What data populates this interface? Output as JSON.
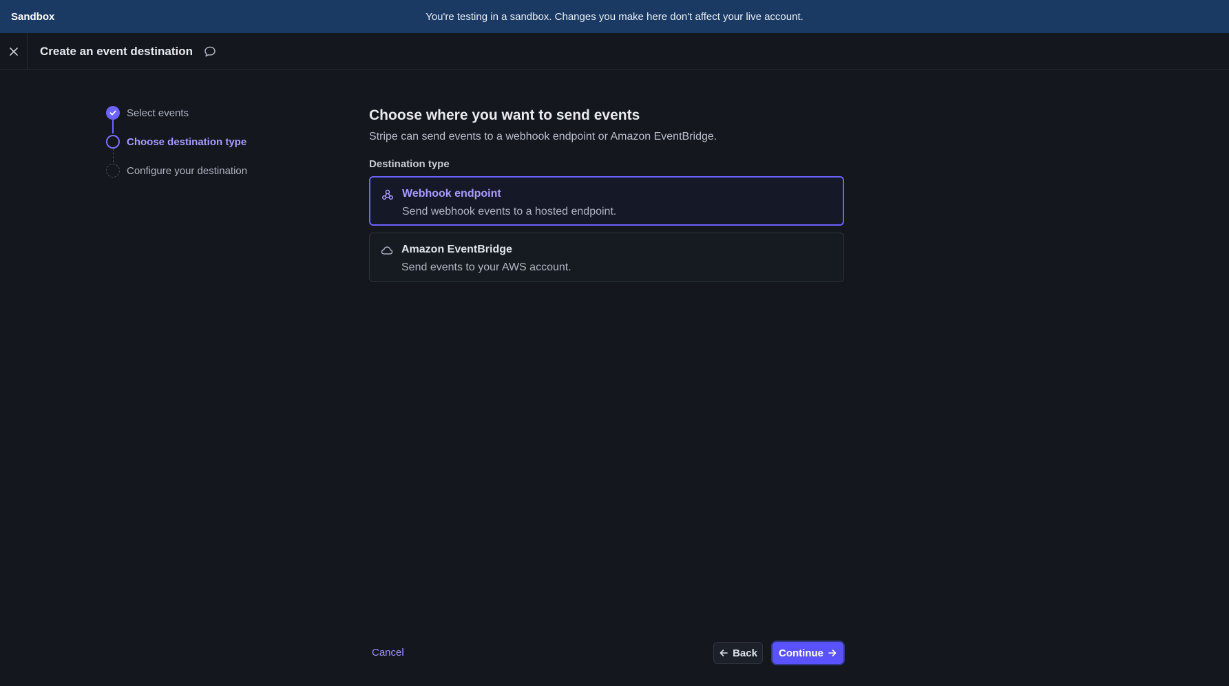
{
  "banner": {
    "label": "Sandbox",
    "message": "You're testing in a sandbox. Changes you make here don't affect your live account."
  },
  "header": {
    "title": "Create an event destination"
  },
  "steps": [
    {
      "label": "Select events",
      "state": "done"
    },
    {
      "label": "Choose destination type",
      "state": "current"
    },
    {
      "label": "Configure your destination",
      "state": "pending"
    }
  ],
  "main": {
    "title": "Choose where you want to send events",
    "subtitle": "Stripe can send events to a webhook endpoint or Amazon EventBridge.",
    "destination_label": "Destination type",
    "options": [
      {
        "title": "Webhook endpoint",
        "description": "Send webhook events to a hosted endpoint.",
        "icon": "webhook-icon",
        "selected": true
      },
      {
        "title": "Amazon EventBridge",
        "description": "Send events to your AWS account.",
        "icon": "cloud-icon",
        "selected": false
      }
    ]
  },
  "footer": {
    "cancel_label": "Cancel",
    "back_label": "Back",
    "continue_label": "Continue"
  },
  "colors": {
    "accent": "#6c63ff",
    "banner_bg": "#1a3a63",
    "page_bg": "#14171e"
  }
}
